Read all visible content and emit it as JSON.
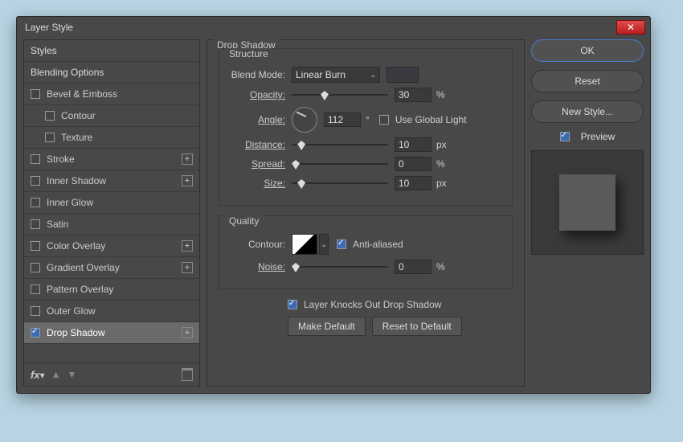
{
  "window": {
    "title": "Layer Style"
  },
  "sidebar": {
    "items": [
      {
        "label": "Styles",
        "check": null,
        "plus": false,
        "sub": false
      },
      {
        "label": "Blending Options",
        "check": null,
        "plus": false,
        "sub": false
      },
      {
        "label": "Bevel & Emboss",
        "check": false,
        "plus": false,
        "sub": false
      },
      {
        "label": "Contour",
        "check": false,
        "plus": false,
        "sub": true
      },
      {
        "label": "Texture",
        "check": false,
        "plus": false,
        "sub": true
      },
      {
        "label": "Stroke",
        "check": false,
        "plus": true,
        "sub": false
      },
      {
        "label": "Inner Shadow",
        "check": false,
        "plus": true,
        "sub": false
      },
      {
        "label": "Inner Glow",
        "check": false,
        "plus": false,
        "sub": false
      },
      {
        "label": "Satin",
        "check": false,
        "plus": false,
        "sub": false
      },
      {
        "label": "Color Overlay",
        "check": false,
        "plus": true,
        "sub": false
      },
      {
        "label": "Gradient Overlay",
        "check": false,
        "plus": true,
        "sub": false
      },
      {
        "label": "Pattern Overlay",
        "check": false,
        "plus": false,
        "sub": false
      },
      {
        "label": "Outer Glow",
        "check": false,
        "plus": false,
        "sub": false
      },
      {
        "label": "Drop Shadow",
        "check": true,
        "plus": true,
        "sub": false,
        "active": true
      }
    ]
  },
  "main": {
    "title": "Drop Shadow",
    "structure": {
      "legend": "Structure",
      "blendMode": {
        "label": "Blend Mode:",
        "value": "Linear Burn"
      },
      "color": "#3a3a44",
      "opacity": {
        "label": "Opacity:",
        "value": "30",
        "unit": "%",
        "pos": 30
      },
      "angle": {
        "label": "Angle:",
        "value": "112",
        "unit": "°",
        "globalLabel": "Use Global Light",
        "global": false
      },
      "distance": {
        "label": "Distance:",
        "value": "10",
        "unit": "px",
        "pos": 6
      },
      "spread": {
        "label": "Spread:",
        "value": "0",
        "unit": "%",
        "pos": 0
      },
      "size": {
        "label": "Size:",
        "value": "10",
        "unit": "px",
        "pos": 6
      }
    },
    "quality": {
      "legend": "Quality",
      "contourLabel": "Contour:",
      "antiAliased": {
        "label": "Anti-aliased",
        "value": true
      },
      "noise": {
        "label": "Noise:",
        "value": "0",
        "unit": "%",
        "pos": 0
      }
    },
    "knockout": {
      "label": "Layer Knocks Out Drop Shadow",
      "value": true
    },
    "makeDefault": "Make Default",
    "resetDefault": "Reset to Default"
  },
  "right": {
    "ok": "OK",
    "reset": "Reset",
    "newStyle": "New Style...",
    "preview": "Preview",
    "previewOn": true
  }
}
